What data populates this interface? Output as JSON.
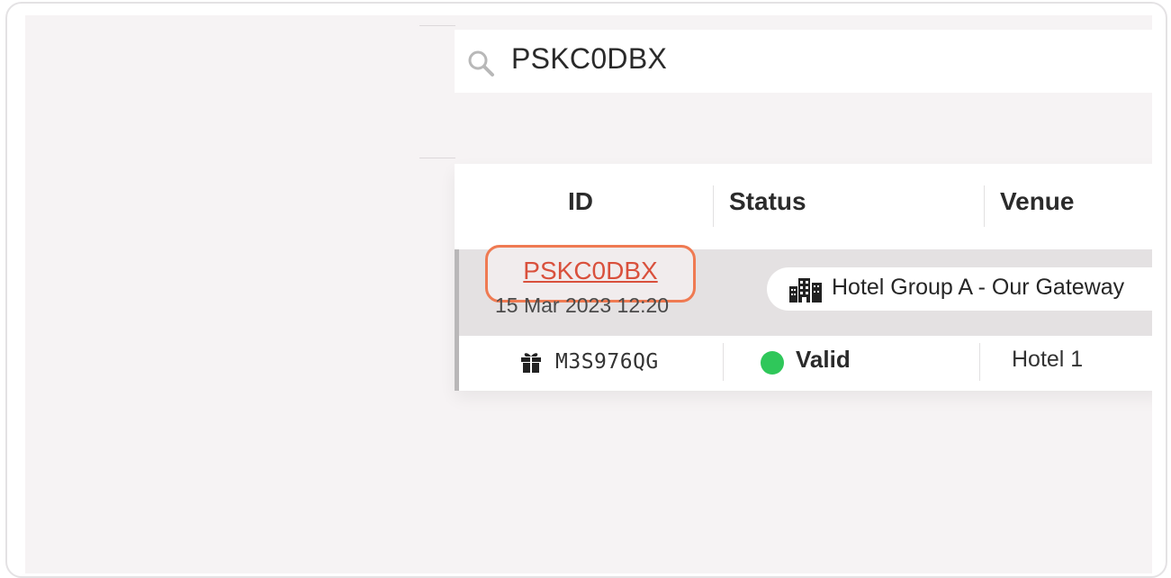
{
  "search": {
    "value": "PSKC0DBX",
    "icon": "search-icon"
  },
  "table": {
    "headers": {
      "id": "ID",
      "status": "Status",
      "venue": "Venue"
    },
    "group_row": {
      "id": "PSKC0DBX",
      "date": "15 Mar 2023 12:20",
      "venue_group": "Hotel Group A - Our Gateway",
      "venue_icon": "building-icon"
    },
    "voucher_row": {
      "icon": "gift-icon",
      "code": "M3S976QG",
      "status": "Valid",
      "status_color": "#2fc75a",
      "venue": "Hotel 1"
    }
  },
  "colors": {
    "highlight_border": "#ef7a52",
    "link": "#d9503c",
    "selected_row_bg": "#e4e1e2"
  }
}
